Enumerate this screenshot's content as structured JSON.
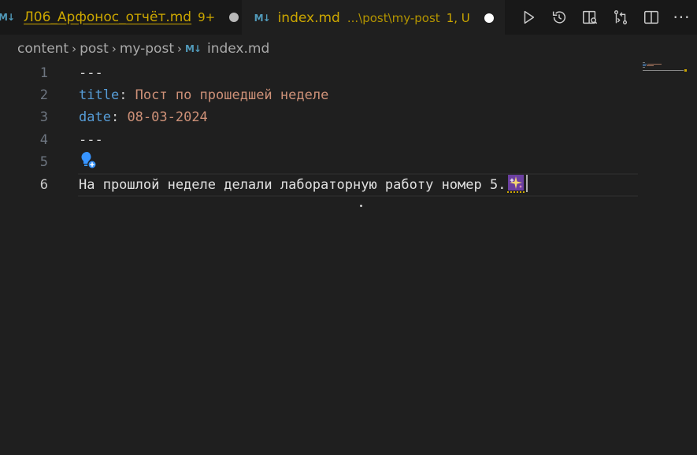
{
  "tabs": [
    {
      "icon": "markdown-icon",
      "icon_text": "M↓",
      "title": "Л06_Арфонос_отчёт.md",
      "path": "",
      "badge": "9+",
      "state": "modified"
    },
    {
      "icon": "markdown-icon",
      "icon_text": "M↓",
      "title": "index.md",
      "path": "...\\post\\my-post",
      "badge": "1, U",
      "state": "unsaved"
    }
  ],
  "editor_actions": [
    "run-icon",
    "timeline-icon",
    "open-preview-icon",
    "compare-changes-icon",
    "split-editor-icon",
    "more-actions-icon"
  ],
  "more_actions_text": "···",
  "breadcrumb": {
    "items": [
      "content",
      "post",
      "my-post"
    ],
    "file_icon_text": "M↓",
    "file": "index.md",
    "separator": "›"
  },
  "editor": {
    "line_numbers": [
      "1",
      "2",
      "3",
      "4",
      "5",
      "6"
    ],
    "active_line": 6,
    "lines": {
      "l1": "---",
      "l2_key": "title",
      "l2_colon": ": ",
      "l2_value": "Пост по прошедшей неделе",
      "l3_key": "date",
      "l3_colon": ": ",
      "l3_value": "08-03-2024",
      "l4": "---",
      "l6": "На прошлой неделе делали лабораторную работу номер 5."
    }
  },
  "colors": {
    "background": "#1f1f1f",
    "tabbar": "#181818",
    "modified_text": "#cca700",
    "yaml_key": "#569cd6",
    "yaml_string": "#ce9178",
    "markdown_icon": "#519aba",
    "lightbulb": "#3794ff"
  }
}
